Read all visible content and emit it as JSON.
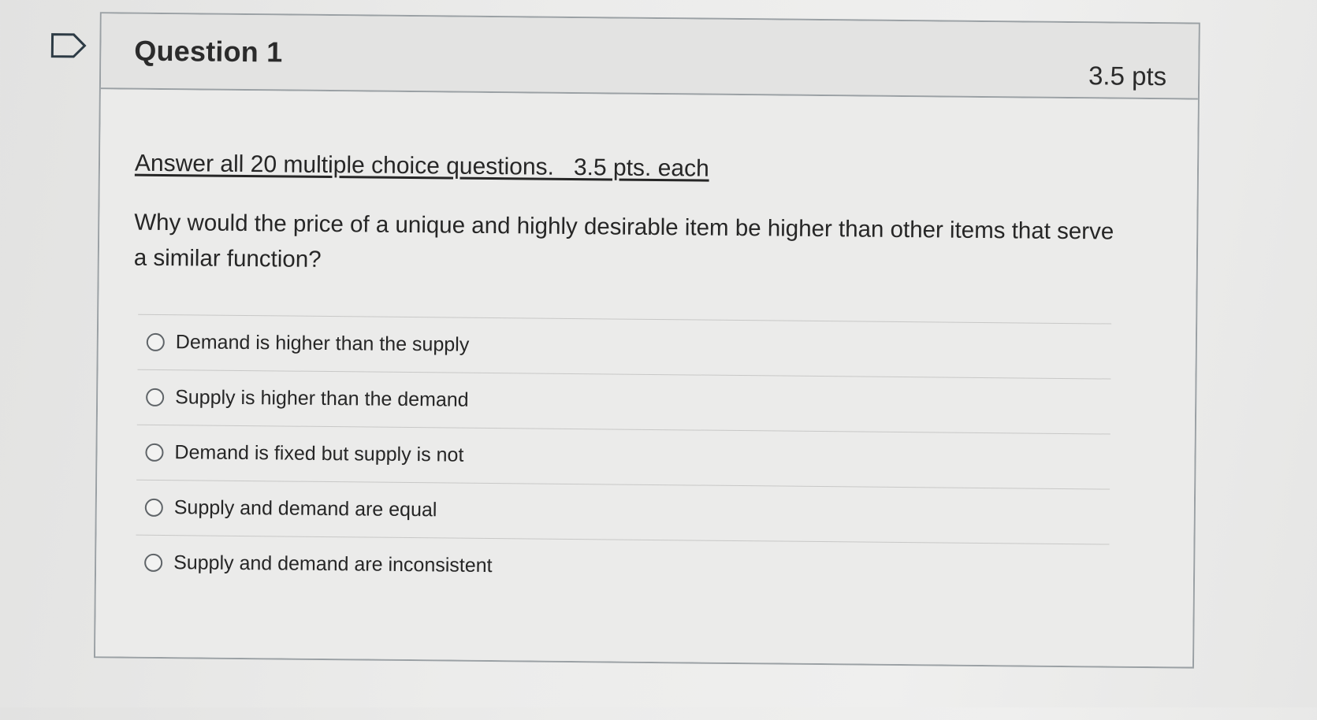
{
  "question": {
    "title": "Question 1",
    "points": "3.5 pts",
    "instruction": "Answer all 20 multiple choice questions.   3.5 pts. each",
    "text": "Why would the price of a unique and highly desirable item be higher than other items that serve a similar function?",
    "flag_icon": "flag-outline-icon",
    "answers": [
      {
        "label": "Demand is higher than the supply",
        "selected": false
      },
      {
        "label": "Supply is higher than the demand",
        "selected": false
      },
      {
        "label": "Demand is fixed but supply is not",
        "selected": false
      },
      {
        "label": "Supply and demand are equal",
        "selected": false
      },
      {
        "label": "Supply and demand are inconsistent",
        "selected": false
      }
    ]
  },
  "colors": {
    "border": "#9aa0a4",
    "header_background": "#e3e3e2",
    "text": "#262626"
  }
}
